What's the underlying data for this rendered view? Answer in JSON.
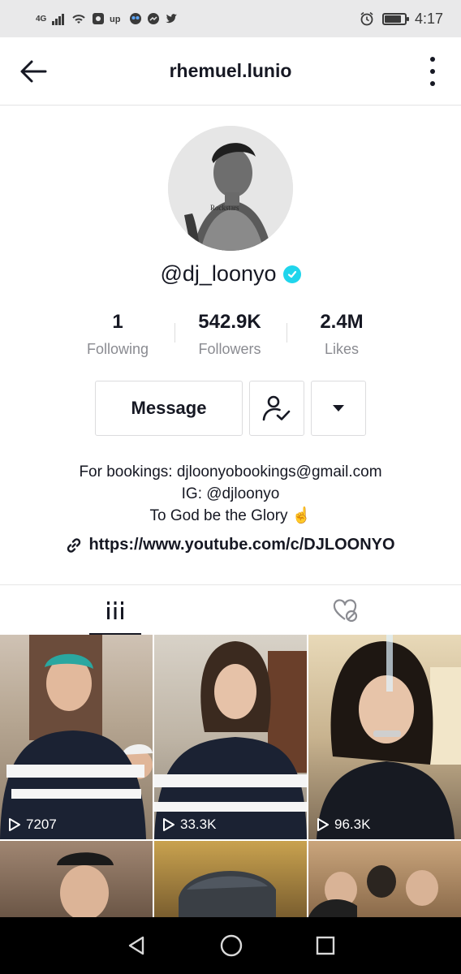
{
  "status_bar": {
    "network": "4G",
    "time": "4:17",
    "battery_level": 0.85
  },
  "header": {
    "title": "rhemuel.lunio"
  },
  "profile": {
    "username": "@dj_loonyo",
    "verified": true,
    "stats": [
      {
        "value": "1",
        "label": "Following"
      },
      {
        "value": "542.9K",
        "label": "Followers"
      },
      {
        "value": "2.4M",
        "label": "Likes"
      }
    ],
    "message_label": "Message",
    "bio_lines": [
      "For bookings: djloonyobookings@gmail.com",
      "IG: @djloonyo",
      "To God be the Glory ☝️"
    ],
    "link": "https://www.youtube.com/c/DJLOONYO"
  },
  "videos": [
    {
      "views": "7207"
    },
    {
      "views": "33.3K"
    },
    {
      "views": "96.3K"
    },
    {
      "views": ""
    },
    {
      "views": ""
    },
    {
      "views": ""
    }
  ],
  "colors": {
    "text_primary": "#161823",
    "text_secondary": "#8a8b91",
    "verified": "#20d5ec",
    "status_bar_bg": "#e9e9ea",
    "nav_bar_bg": "#000000"
  },
  "icons": {
    "back": "arrow-left-icon",
    "more": "vertical-dots-icon",
    "follow": "user-check-icon",
    "dropdown": "caret-down-icon",
    "link": "chain-link-icon",
    "videos_tab": "grid-bars-icon",
    "liked_tab": "heart-hidden-icon",
    "views": "play-outline-icon",
    "nav_back": "triangle-back-icon",
    "nav_home": "circle-home-icon",
    "nav_recents": "square-recents-icon"
  }
}
